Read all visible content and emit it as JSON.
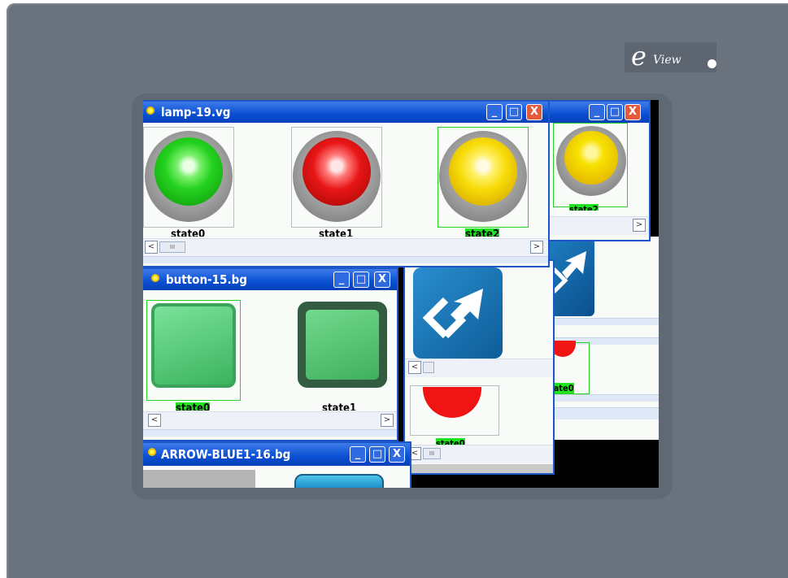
{
  "device": {
    "logo_letter": "e",
    "logo_text": "View"
  },
  "windows": {
    "lamp": {
      "title": "lamp-19.vg",
      "states": [
        "state0",
        "state1",
        "state2"
      ],
      "colors": [
        "#25d21f",
        "#e81616",
        "#f7dc08"
      ]
    },
    "lamp_back": {
      "state_label": "state2"
    },
    "button": {
      "title": "button-15.bg",
      "states": [
        "state0",
        "state1"
      ]
    },
    "arrow": {
      "title": "ARROW-BLUE1-16.bg"
    },
    "blue_back": {
      "state_label": "state0"
    },
    "red_back": {
      "state_label": "state0"
    },
    "ctl": {
      "min": "_",
      "max": "□",
      "close": "X"
    },
    "scroll": {
      "left": "<",
      "right": ">",
      "thumb": "III"
    }
  }
}
